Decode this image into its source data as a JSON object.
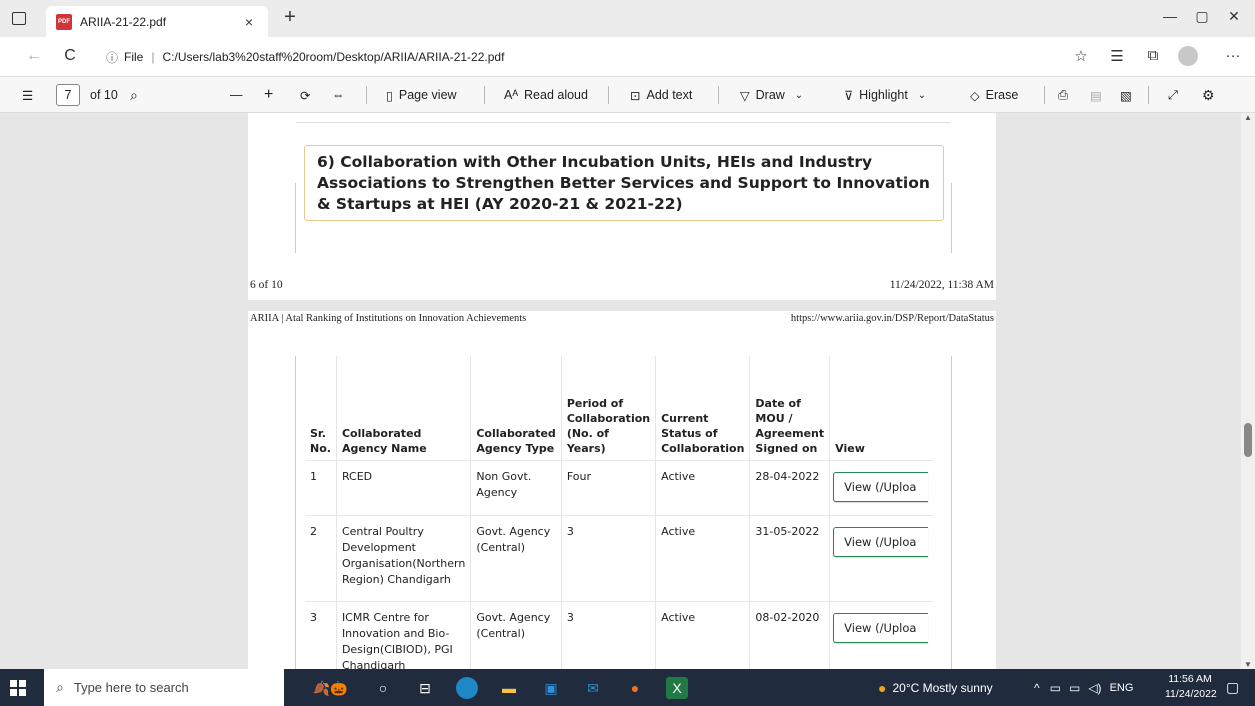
{
  "window": {
    "tab_title": "ARIIA-21-22.pdf",
    "tab_close": "×",
    "new_tab": "+",
    "minimize": "—",
    "maximize": "▢",
    "close": "✕"
  },
  "addressbar": {
    "back": "←",
    "refresh": "C",
    "info_label": "File",
    "url": "C:/Users/lab3%20staff%20room/Desktop/ARIIA/ARIIA-21-22.pdf",
    "more": "···"
  },
  "pdf_toolbar": {
    "page_number": "7",
    "page_total": "of 10",
    "zoom_out": "—",
    "zoom_in": "+",
    "page_view": "Page view",
    "read_aloud": "Read aloud",
    "add_text": "Add text",
    "draw": "Draw",
    "highlight": "Highlight",
    "erase": "Erase"
  },
  "page_top": {
    "heading": "6) Collaboration with Other Incubation Units, HEIs and Industry Associations to Strengthen Better Services and Support to Innovation & Startups at HEI (AY 2020-21 & 2021-22)",
    "footer_left": "6 of 10",
    "footer_right": "11/24/2022, 11:38 AM"
  },
  "page_bottom": {
    "header_left": "ARIIA | Atal Ranking of Institutions on Innovation Achievements",
    "header_right": "https://www.ariia.gov.in/DSP/Report/DataStatus"
  },
  "table": {
    "headers": [
      "Sr. No.",
      "Collaborated Agency Name",
      "Collaborated Agency Type",
      "Period of Collaboration (No. of Years)",
      "Current Status of Collaboration",
      "Date of MOU / Agreement Signed on",
      "View"
    ],
    "rows": [
      {
        "sr": "1",
        "name": "RCED",
        "type": "Non Govt. Agency",
        "period": "Four",
        "status": "Active",
        "date": "28-04-2022",
        "view": "View (/Uploa"
      },
      {
        "sr": "2",
        "name": "Central Poultry Development Organisation(Northern Region) Chandigarh",
        "type": "Govt. Agency (Central)",
        "period": "3",
        "status": "Active",
        "date": "31-05-2022",
        "view": "View (/Uploa"
      },
      {
        "sr": "3",
        "name": "ICMR Centre for Innovation and Bio-Design(CIBIOD), PGI Chandigarh",
        "type": "Govt. Agency (Central)",
        "period": "3",
        "status": "Active",
        "date": "08-02-2020",
        "view": "View (/Uploa"
      }
    ]
  },
  "taskbar": {
    "search_placeholder": "Type here to search",
    "weather": "20°C  Mostly sunny",
    "language": "ENG",
    "time": "11:56 AM",
    "date": "11/24/2022"
  },
  "colors": {
    "accent_border": "#e8c98e",
    "view_button_border": "#1f8a4c",
    "taskbar": "#202b3d"
  }
}
